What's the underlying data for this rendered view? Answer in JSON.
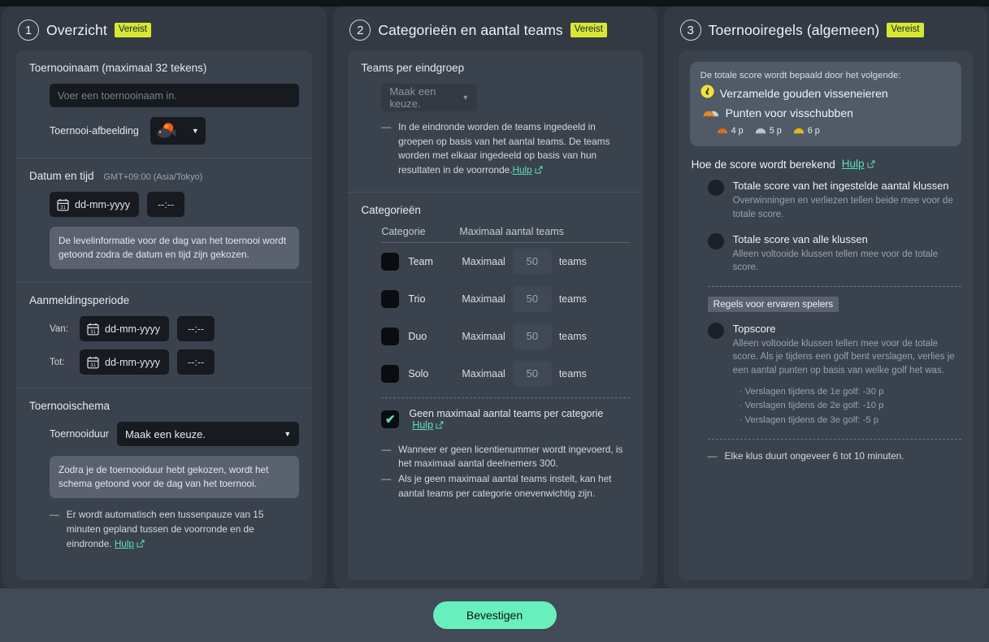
{
  "colors": {
    "accent": "#68efbe",
    "badge": "#d6e832",
    "link": "#5ee0b4",
    "page_bg": "#2b323b",
    "card_bg": "#3a424d"
  },
  "sections": [
    {
      "number": "1",
      "title": "Overzicht",
      "badge": "Vereist"
    },
    {
      "number": "2",
      "title": "Categorieën en aantal teams",
      "badge": "Vereist"
    },
    {
      "number": "3",
      "title": "Toernooiregels (algemeen)",
      "badge": "Vereist"
    }
  ],
  "panel1": {
    "name_block": {
      "label": "Toernooinaam (maximaal 32 tekens)",
      "input_placeholder": "Voer een toernooinaam in.",
      "image_label": "Toernooi-afbeelding"
    },
    "datetime_block": {
      "label": "Datum en tijd",
      "timezone": "GMT+09:00 (Asia/Tokyo)",
      "date_placeholder": "dd-mm-yyyy",
      "time_placeholder": "--:--",
      "notice": "De levelinformatie voor de dag van het toernooi wordt getoond zodra de datum en tijd zijn gekozen."
    },
    "registration_block": {
      "label": "Aanmeldingsperiode",
      "from_label": "Van:",
      "to_label": "Tot:",
      "date_placeholder": "dd-mm-yyyy",
      "time_placeholder": "--:--"
    },
    "schedule_block": {
      "label": "Toernooischema",
      "duration_label": "Toernooiduur",
      "duration_value": "Maak een keuze.",
      "notice": "Zodra je de toernooiduur hebt gekozen, wordt het schema getoond voor de dag van het toernooi.",
      "hint": "Er wordt automatisch een tussenpauze van 15 minuten gepland tussen de voorronde en de eindronde.",
      "hint_link": "Hulp"
    }
  },
  "panel2": {
    "group_block": {
      "label": "Teams per eindgroep",
      "select_value": "Maak een keuze.",
      "hint": "In de eindronde worden de teams ingedeeld in groepen op basis van het aantal teams. De teams worden met elkaar ingedeeld op basis van hun resultaten in de voorronde.",
      "hint_link": "Hulp"
    },
    "categories_block": {
      "label": "Categorieën",
      "col_category": "Categorie",
      "col_max": "Maximaal aantal teams",
      "max_prefix": "Maximaal",
      "teams_suffix": "teams",
      "rows": [
        {
          "name": "Team",
          "max_placeholder": "50",
          "checked": false
        },
        {
          "name": "Trio",
          "max_placeholder": "50",
          "checked": false
        },
        {
          "name": "Duo",
          "max_placeholder": "50",
          "checked": false
        },
        {
          "name": "Solo",
          "max_placeholder": "50",
          "checked": false
        }
      ],
      "no_max_label": "Geen maximaal aantal teams per categorie",
      "no_max_link": "Hulp",
      "no_max_checked": true,
      "hints": [
        "Wanneer er geen licentienummer wordt ingevoerd, is het maximaal aantal deelnemers 300.",
        "Als je geen maximaal aantal teams instelt, kan het aantal teams per categorie onevenwichtig zijn."
      ]
    }
  },
  "panel3": {
    "score_box": {
      "intro": "De totale score wordt bepaald door het volgende:",
      "items": [
        {
          "icon": "golden-fish-egg-icon",
          "label": "Verzamelde gouden visseneieren"
        },
        {
          "icon": "fish-scales-icon",
          "label": "Punten voor visschubben"
        }
      ],
      "points": [
        {
          "icon": "bronze-scale-icon",
          "label": "4 p"
        },
        {
          "icon": "silver-scale-icon",
          "label": "5 p"
        },
        {
          "icon": "gold-scale-icon",
          "label": "6 p"
        }
      ]
    },
    "calc_title": "Hoe de score wordt berekend",
    "calc_link": "Hulp",
    "options": [
      {
        "title": "Totale score van het ingestelde aantal klussen",
        "desc": "Overwinningen en verliezen tellen beide mee voor de totale score."
      },
      {
        "title": "Totale score van alle klussen",
        "desc": "Alleen voltooide klussen tellen mee voor de totale score."
      }
    ],
    "experienced_tag": "Regels voor ervaren spelers",
    "topscore": {
      "title": "Topscore",
      "desc": "Alleen voltooide klussen tellen mee voor de totale score. Als je tijdens een golf bent verslagen, verlies je een aantal punten op basis van welke golf het was.",
      "bullets": [
        "Verslagen tijdens de 1e golf: -30 p",
        "Verslagen tijdens de 2e golf: -10 p",
        "Verslagen tijdens de 3e golf:   -5 p"
      ]
    },
    "footer_hint": "Elke klus duurt ongeveer 6 tot 10 minuten."
  },
  "footer": {
    "confirm_label": "Bevestigen"
  }
}
